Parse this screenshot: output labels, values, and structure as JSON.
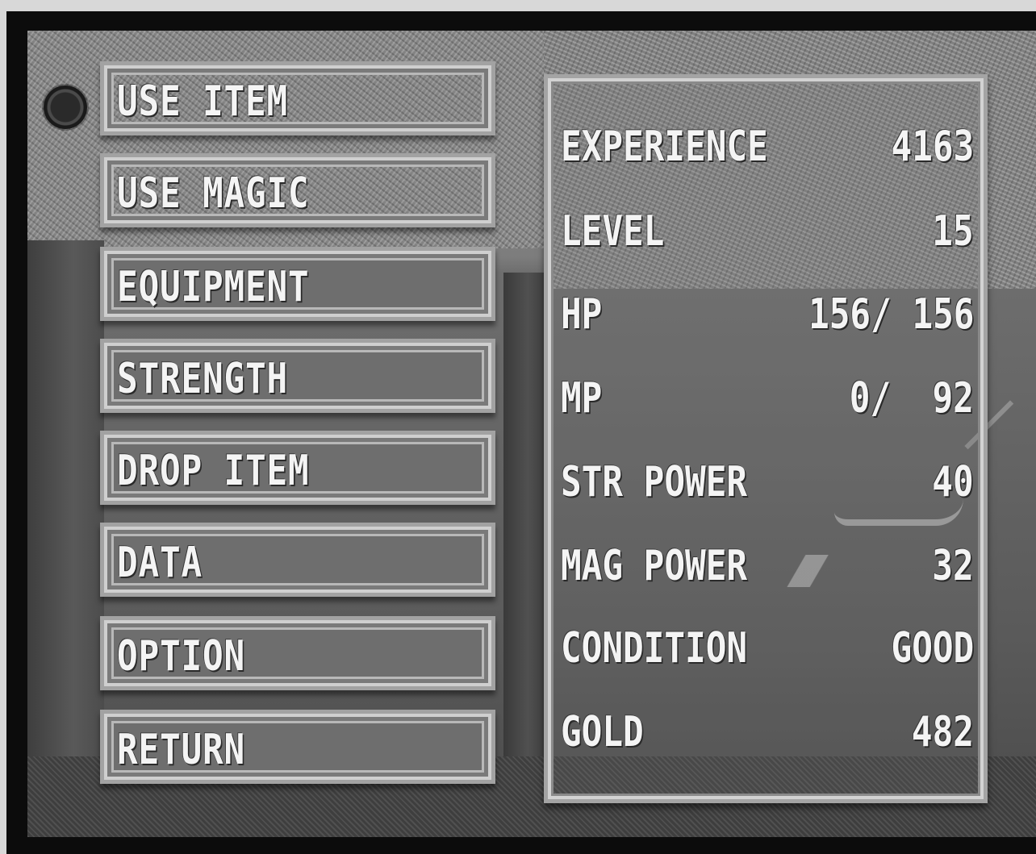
{
  "menu": {
    "items": [
      {
        "label": "USE ITEM"
      },
      {
        "label": "USE MAGIC"
      },
      {
        "label": "EQUIPMENT"
      },
      {
        "label": "STRENGTH"
      },
      {
        "label": "DROP ITEM"
      },
      {
        "label": "DATA"
      },
      {
        "label": "OPTION"
      },
      {
        "label": "RETURN"
      }
    ],
    "selected_index": 0,
    "cursor_icon": "orb-cursor-icon"
  },
  "stats": {
    "rows": [
      {
        "label": "EXPERIENCE",
        "value": "4163"
      },
      {
        "label": "LEVEL",
        "value": "15"
      },
      {
        "label": "HP",
        "value": "156/ 156"
      },
      {
        "label": "MP",
        "value": "0/  92"
      },
      {
        "label": "STR POWER",
        "value": "40"
      },
      {
        "label": "MAG POWER",
        "value": "32"
      },
      {
        "label": "CONDITION",
        "value": "GOOD"
      },
      {
        "label": "GOLD",
        "value": "482"
      }
    ]
  }
}
